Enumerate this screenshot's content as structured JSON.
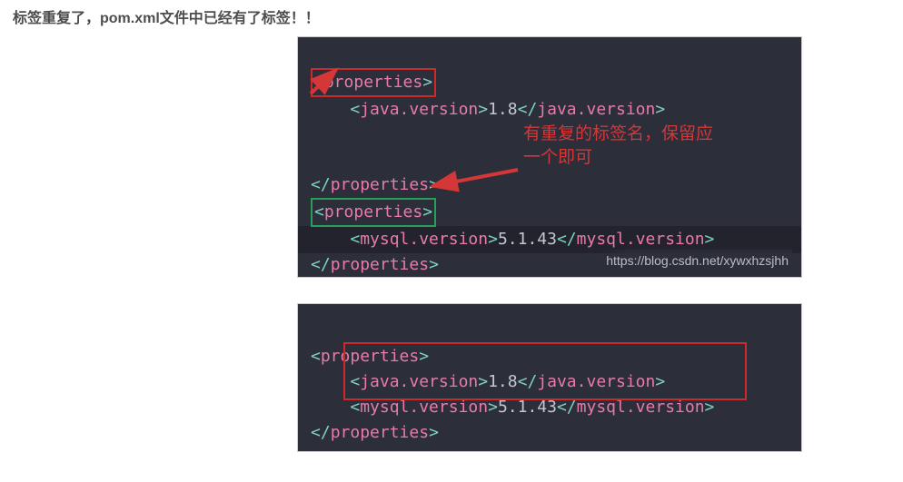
{
  "heading": "标签重复了，pom.xml文件中已经有了标签！！",
  "block1": {
    "line1_open": "properties",
    "line2_tag": "java.version",
    "line2_val": "1.8",
    "line3_close": "properties",
    "line4_open": "properties",
    "line5_tag": "mysql.version",
    "line5_val": "5.1.43",
    "line6_close": "properties",
    "annotation_l1": "有重复的标签名，保留应",
    "annotation_l2": "一个即可",
    "watermark": "https://blog.csdn.net/xywxhzsjhh"
  },
  "block2": {
    "line1_open": "properties",
    "line2_tag": "java.version",
    "line2_val": "1.8",
    "line3_tag": "mysql.version",
    "line3_val": "5.1.43",
    "line4_close": "properties"
  }
}
